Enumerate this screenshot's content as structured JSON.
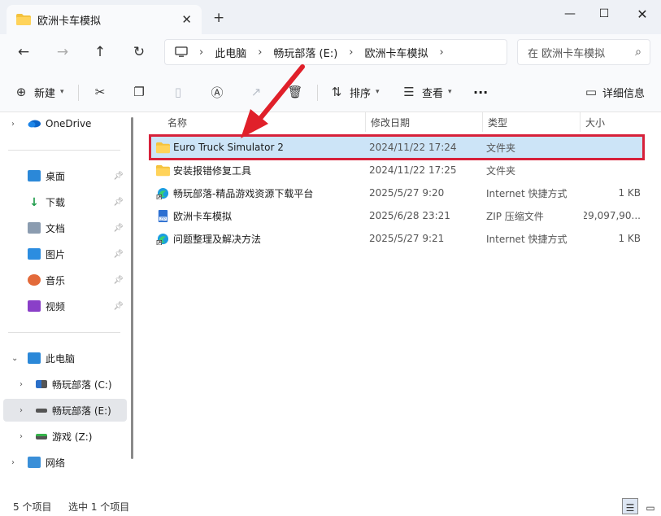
{
  "tab": {
    "title": "欧洲卡车模拟",
    "close": "✕",
    "new_tab": "+"
  },
  "window": {
    "minimize": "—",
    "maximize": "☐",
    "close": "✕"
  },
  "nav": {
    "back": "←",
    "forward": "→",
    "up": "↑",
    "refresh": "↻",
    "breadcrumbs": [
      "此电脑",
      "畅玩部落 (E:)",
      "欧洲卡车模拟"
    ],
    "search_placeholder": "在 欧洲卡车模拟"
  },
  "toolbar": {
    "new_label": "新建",
    "sort_label": "排序",
    "view_label": "查看",
    "more": "···",
    "details_label": "详细信息"
  },
  "sidebar": {
    "onedrive": "OneDrive",
    "quick": [
      "桌面",
      "下载",
      "文档",
      "图片",
      "音乐",
      "视频"
    ],
    "this_pc": "此电脑",
    "drives": [
      "畅玩部落 (C:)",
      "畅玩部落 (E:)",
      "游戏 (Z:)"
    ],
    "network": "网络"
  },
  "columns": {
    "name": "名称",
    "date": "修改日期",
    "type": "类型",
    "size": "大小"
  },
  "files": [
    {
      "name": "Euro Truck Simulator 2",
      "date": "2024/11/22 17:24",
      "type": "文件夹",
      "size": "",
      "icon": "folder-icon"
    },
    {
      "name": "安装报错修复工具",
      "date": "2024/11/22 17:25",
      "type": "文件夹",
      "size": "",
      "icon": "folder-icon"
    },
    {
      "name": "畅玩部落-精品游戏资源下载平台",
      "date": "2025/5/27 9:20",
      "type": "Internet 快捷方式",
      "size": "1 KB",
      "icon": "edge-shortcut-icon"
    },
    {
      "name": "欧洲卡车模拟",
      "date": "2025/6/28 23:21",
      "type": "ZIP 压缩文件",
      "size": "29,097,90...",
      "icon": "zip-icon"
    },
    {
      "name": "问题整理及解决方法",
      "date": "2025/5/27 9:21",
      "type": "Internet 快捷方式",
      "size": "1 KB",
      "icon": "edge-shortcut-icon"
    }
  ],
  "status": {
    "count": "5 个项目",
    "selected": "选中 1 个项目"
  },
  "colors": {
    "selection": "#cce4f7",
    "highlight_border": "#d7213a",
    "arrow": "#e0202a",
    "folder": "#f4c23d"
  }
}
